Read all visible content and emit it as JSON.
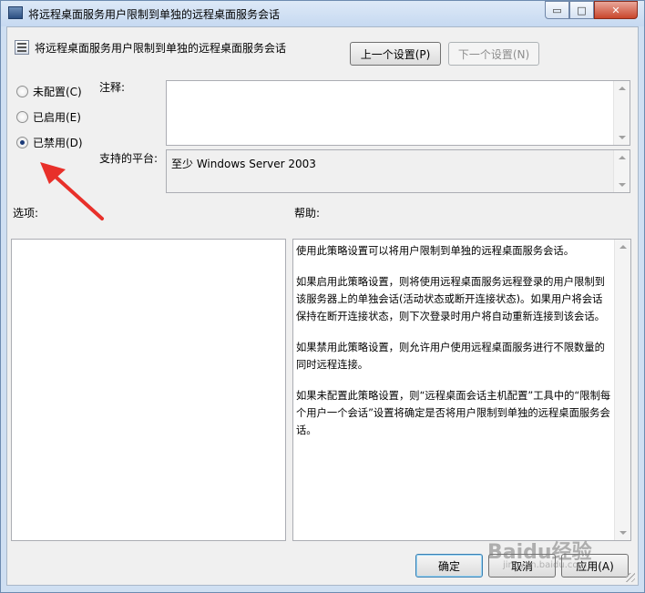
{
  "window": {
    "title": "将远程桌面服务用户限制到单独的远程桌面服务会话",
    "controls": {
      "minimize": "▭",
      "maximize": "□",
      "close": "✕"
    }
  },
  "header": {
    "title": "将远程桌面服务用户限制到单独的远程桌面服务会话",
    "prev_button": "上一个设置(P)",
    "next_button": "下一个设置(N)"
  },
  "state": {
    "options": [
      {
        "label": "未配置(C)",
        "checked": false
      },
      {
        "label": "已启用(E)",
        "checked": false
      },
      {
        "label": "已禁用(D)",
        "checked": true
      }
    ]
  },
  "comment": {
    "label": "注释:",
    "value": ""
  },
  "platform": {
    "label": "支持的平台:",
    "value": "至少 Windows Server 2003"
  },
  "options_section": {
    "label": "选项:"
  },
  "help_section": {
    "label": "帮助:",
    "paragraphs": [
      "使用此策略设置可以将用户限制到单独的远程桌面服务会话。",
      "如果启用此策略设置，则将使用远程桌面服务远程登录的用户限制到该服务器上的单独会话(活动状态或断开连接状态)。如果用户将会话保持在断开连接状态，则下次登录时用户将自动重新连接到该会话。",
      "如果禁用此策略设置，则允许用户使用远程桌面服务进行不限数量的同时远程连接。",
      "如果未配置此策略设置，则“远程桌面会话主机配置”工具中的“限制每个用户一个会话”设置将确定是否将用户限制到单独的远程桌面服务会话。"
    ]
  },
  "footer": {
    "ok": "确定",
    "cancel": "取消",
    "apply": "应用(A)"
  },
  "watermark": {
    "brand": "Baidu经验",
    "url": "jingyan.baidu.com"
  },
  "colors": {
    "annotation_arrow": "#e8302a",
    "window_frame": "#cfdff2"
  }
}
